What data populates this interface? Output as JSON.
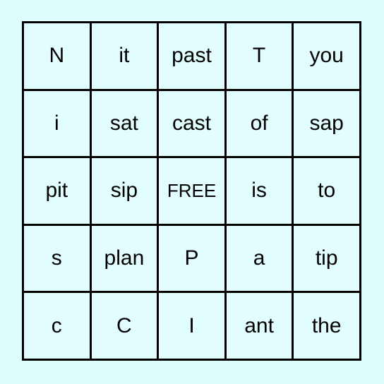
{
  "card": {
    "type": "bingo-card",
    "rows": 5,
    "columns": 5,
    "page_background": "#dffcfc",
    "cell_background": "#e2fdfd",
    "grid_line_color": "#000000",
    "text_color": "#000000",
    "free_space": {
      "row": 3,
      "column": 3,
      "label": "FREE"
    },
    "cells": [
      [
        {
          "text": "N",
          "free": false
        },
        {
          "text": "it",
          "free": false
        },
        {
          "text": "past",
          "free": false
        },
        {
          "text": "T",
          "free": false
        },
        {
          "text": "you",
          "free": false
        }
      ],
      [
        {
          "text": "i",
          "free": false
        },
        {
          "text": "sat",
          "free": false
        },
        {
          "text": "cast",
          "free": false
        },
        {
          "text": "of",
          "free": false
        },
        {
          "text": "sap",
          "free": false
        }
      ],
      [
        {
          "text": "pit",
          "free": false
        },
        {
          "text": "sip",
          "free": false
        },
        {
          "text": "FREE",
          "free": true
        },
        {
          "text": "is",
          "free": false
        },
        {
          "text": "to",
          "free": false
        }
      ],
      [
        {
          "text": "s",
          "free": false
        },
        {
          "text": "plan",
          "free": false
        },
        {
          "text": "P",
          "free": false
        },
        {
          "text": "a",
          "free": false
        },
        {
          "text": "tip",
          "free": false
        }
      ],
      [
        {
          "text": "c",
          "free": false
        },
        {
          "text": "C",
          "free": false
        },
        {
          "text": "I",
          "free": false
        },
        {
          "text": "ant",
          "free": false
        },
        {
          "text": "the",
          "free": false
        }
      ]
    ]
  }
}
